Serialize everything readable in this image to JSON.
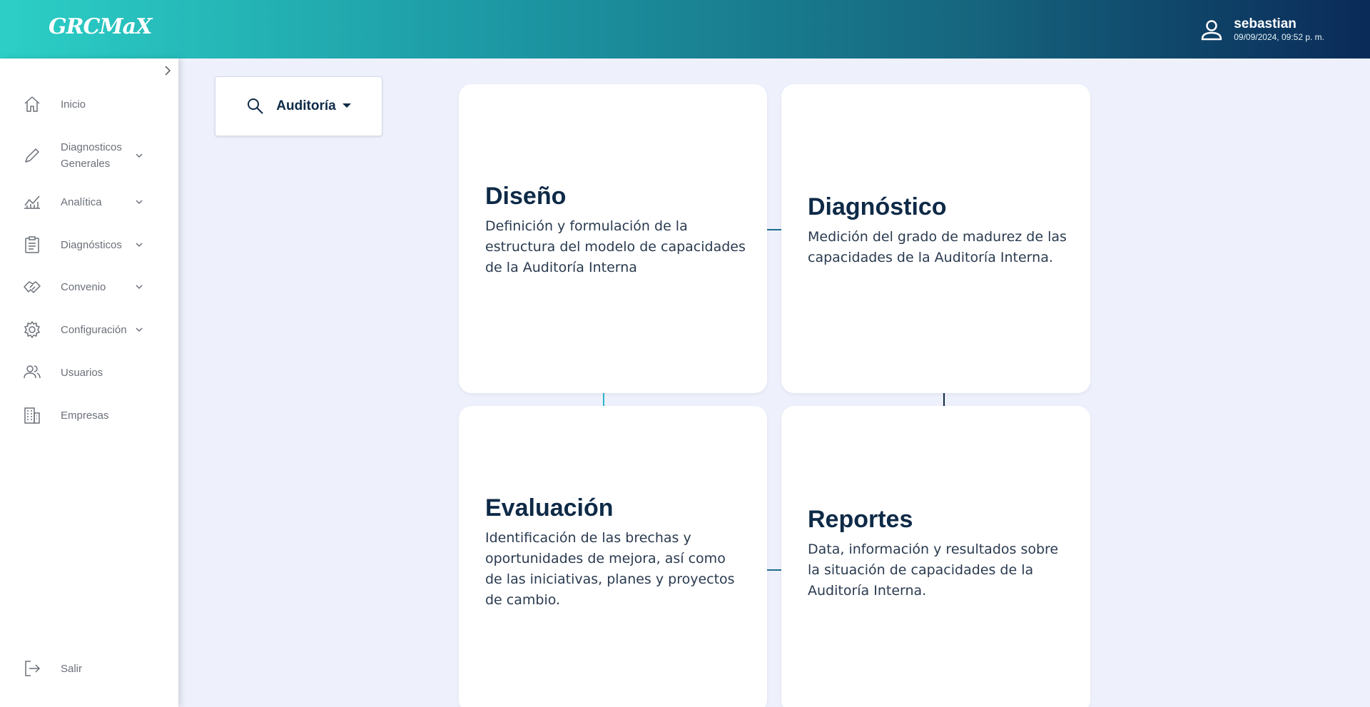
{
  "header": {
    "logo_text": "GRCMaX",
    "user": {
      "name": "sebastian",
      "datetime": "09/09/2024, 09:52 p. m."
    }
  },
  "sidebar": {
    "items": [
      {
        "label": "Inicio",
        "icon": "home-icon",
        "has_submenu": false
      },
      {
        "label": "Diagnosticos Generales",
        "icon": "pencil-icon",
        "has_submenu": true
      },
      {
        "label": "Analítica",
        "icon": "chart-line-icon",
        "has_submenu": true
      },
      {
        "label": "Diagnósticos",
        "icon": "clipboard-icon",
        "has_submenu": true
      },
      {
        "label": "Convenio",
        "icon": "handshake-icon",
        "has_submenu": true
      },
      {
        "label": "Configuración",
        "icon": "gear-icon",
        "has_submenu": true
      },
      {
        "label": "Usuarios",
        "icon": "users-icon",
        "has_submenu": false
      },
      {
        "label": "Empresas",
        "icon": "building-icon",
        "has_submenu": false
      }
    ],
    "logout_label": "Salir"
  },
  "search": {
    "selected": "Auditoría"
  },
  "cards": [
    {
      "title": "Diseño",
      "description": "Definición y formulación de la estructura del modelo de capacidades de la Auditoría Interna"
    },
    {
      "title": "Diagnóstico",
      "description": "Medición del grado de madurez de las capacidades de la Auditoría Interna."
    },
    {
      "title": "Evaluación",
      "description": "Identificación de las brechas y oportunidades de mejora, así como de las iniciativas, planes y proyectos de cambio."
    },
    {
      "title": "Reportes",
      "description": "Data, información y resultados sobre la situación de capacidades de la Auditoría Interna."
    }
  ],
  "colors": {
    "header_gradient": [
      "#2ccfc6",
      "#1d9aa5",
      "#16677f",
      "#0a2a58"
    ],
    "page_background": "#eef1fc",
    "title_color": "#0e2a47",
    "connector_teal": "#1d8fa3",
    "connector_navy": "#0e2a47"
  }
}
